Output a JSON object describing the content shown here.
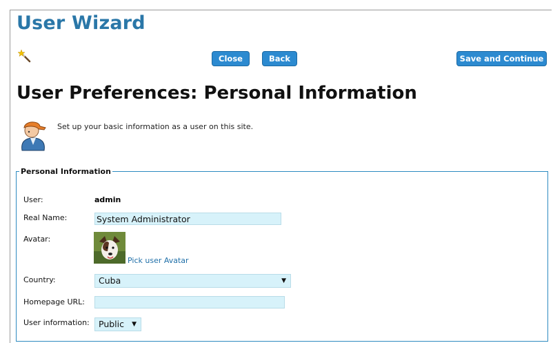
{
  "wizard": {
    "title": "User Wizard"
  },
  "toolbar": {
    "close_label": "Close",
    "back_label": "Back",
    "save_label": "Save and Continue"
  },
  "page": {
    "title": "User Preferences: Personal Information",
    "intro": "Set up your basic information as a user on this site."
  },
  "personal": {
    "legend": "Personal Information",
    "user_label": "User:",
    "user_value": "admin",
    "realname_label": "Real Name:",
    "realname_value": "System Administrator",
    "avatar_label": "Avatar:",
    "pick_avatar_link": "Pick user Avatar",
    "country_label": "Country:",
    "country_value": "Cuba",
    "homepage_label": "Homepage URL:",
    "homepage_value": "",
    "userinfo_label": "User information:",
    "userinfo_value": "Public",
    "dropdown_arrow": "▼"
  },
  "icons": {
    "wizard": "magic-wand-icon",
    "user": "user-avatar-icon",
    "dog": "dog-avatar-image"
  },
  "colors": {
    "brand": "#2a77a8",
    "button": "#2c8ad0",
    "input_bg": "#d7f2fa",
    "fieldset_border": "#2c8ac0"
  }
}
